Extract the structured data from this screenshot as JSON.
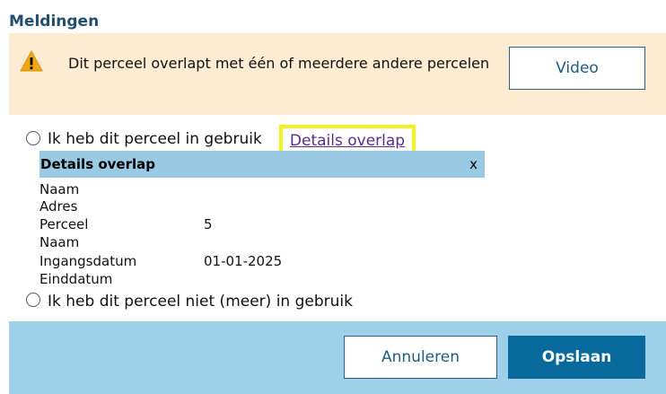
{
  "title": "Meldingen",
  "alert": {
    "icon": "warning-icon",
    "message": "Dit perceel overlapt met één of meerdere andere percelen",
    "video_label": "Video"
  },
  "options": {
    "in_use_label": "Ik heb dit perceel in gebruik",
    "details_link": "Details overlap",
    "not_in_use_label": "Ik heb dit perceel niet (meer) in gebruik"
  },
  "overlap": {
    "title": "Details overlap",
    "close": "x",
    "rows": [
      {
        "label": "Naam",
        "value": ""
      },
      {
        "label": "Adres",
        "value": ""
      },
      {
        "label": "Perceel",
        "value": "5"
      },
      {
        "label": "Naam",
        "value": ""
      },
      {
        "label": "Ingangsdatum",
        "value": "01-01-2025"
      },
      {
        "label": "Einddatum",
        "value": ""
      }
    ]
  },
  "footer": {
    "cancel_label": "Annuleren",
    "save_label": "Opslaan"
  },
  "colors": {
    "alert_bg": "#fdebd2",
    "bar_bg": "#9fd0e9",
    "header_bg": "#99c9e3",
    "primary": "#07699c",
    "highlight": "#f2f21e"
  }
}
